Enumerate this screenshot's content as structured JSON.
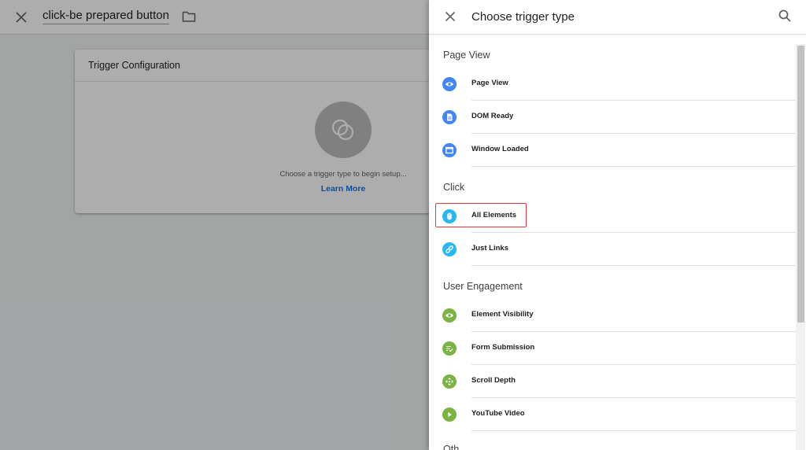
{
  "background": {
    "tag_title": "click-be prepared button",
    "card": {
      "title": "Trigger Configuration",
      "hint": "Choose a trigger type to begin setup...",
      "link": "Learn More"
    }
  },
  "drawer": {
    "title": "Choose trigger type",
    "sections": [
      {
        "label": "Page View",
        "items": [
          "Page View",
          "DOM Ready",
          "Window Loaded"
        ]
      },
      {
        "label": "Click",
        "items": [
          "All Elements",
          "Just Links"
        ]
      },
      {
        "label": "User Engagement",
        "items": [
          "Element Visibility",
          "Form Submission",
          "Scroll Depth",
          "YouTube Video"
        ]
      }
    ],
    "next_section_peek": "Oth"
  },
  "colors": {
    "page_view_icon": "#4285f4",
    "click_icon": "#29b6f6",
    "engagement_icon": "#7cb342",
    "link": "#1a73e8",
    "highlight": "#e53935"
  },
  "icons": {
    "page_view": "eye-icon",
    "dom_ready": "document-icon",
    "window_loaded": "window-icon",
    "all_elements": "mouse-icon",
    "just_links": "link-icon",
    "element_visibility": "eye-icon",
    "form_submission": "form-icon",
    "scroll_depth": "move-arrows-icon",
    "youtube_video": "play-icon"
  }
}
